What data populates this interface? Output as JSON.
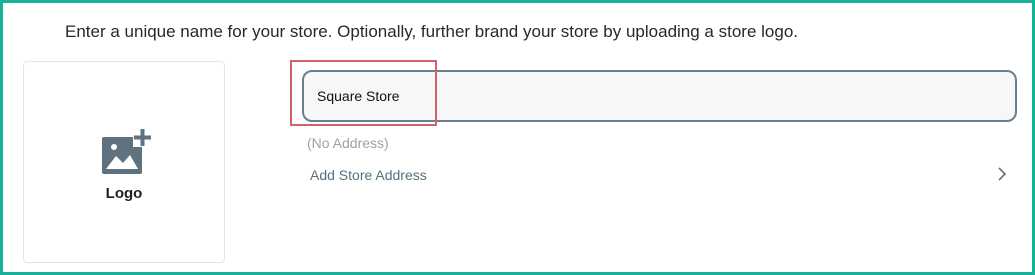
{
  "instructions": "Enter a unique name for your store. Optionally, further brand your store by uploading a store logo.",
  "logo": {
    "label": "Logo",
    "icon": "add-image-icon"
  },
  "store_name": {
    "value": "Square Store"
  },
  "address": {
    "empty_text": "(No Address)",
    "add_label": "Add Store Address",
    "icon": "chevron-right-icon"
  },
  "colors": {
    "frame_border": "#17b19a",
    "input_border": "#6a7f8c",
    "highlight": "#d0636b",
    "link": "#55707d",
    "icon": "#5e737f"
  }
}
